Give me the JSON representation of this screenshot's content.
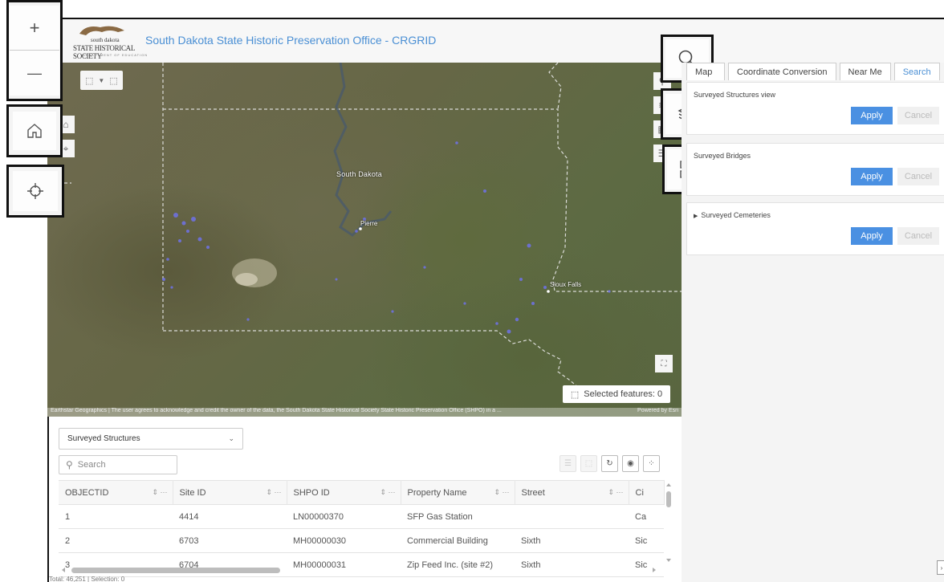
{
  "header": {
    "logo_line1": "south dakota",
    "logo_line2": "STATE HISTORICAL SOCIETY",
    "logo_line3": "DEPARTMENT OF EDUCATION",
    "title": "South Dakota State Historic Preservation Office - CRGRID"
  },
  "map": {
    "toolbar": {
      "select_icon": "select-by-rectangle-icon",
      "dropdown_icon": "chevron-down-icon",
      "clear_icon": "clear-selection-icon"
    },
    "labels": {
      "state": "South Dakota",
      "pierre": "Pierre",
      "sioux_falls": "Sioux Falls"
    },
    "selected_features_label": "Selected features: 0",
    "attribution_left": "Earthstar Geographics | The user agrees to acknowledge and credit the owner of the data, the South Dakota State Historical Society State Historic Preservation Office (SHPO) in a ...",
    "attribution_right": "Powered by Esri",
    "controls": {
      "zoom_in": "+",
      "zoom_out": "—",
      "home_icon": "home-icon",
      "locate_icon": "crosshair-icon",
      "search_icon": "search-icon",
      "layers_icon": "layers-icon",
      "basemap_icon": "basemap-gallery-icon"
    }
  },
  "attribute_table": {
    "layer_select_value": "Surveyed Structures",
    "search_placeholder": "Search",
    "columns": [
      "OBJECTID",
      "Site ID",
      "SHPO ID",
      "Property Name",
      "Street",
      "Ci"
    ],
    "rows": [
      [
        "1",
        "4414",
        "LN00000370",
        "SFP Gas Station",
        "",
        "Ca"
      ],
      [
        "2",
        "6703",
        "MH00000030",
        "Commercial Building",
        "Sixth",
        "Sic"
      ],
      [
        "3",
        "6704",
        "MH00000031",
        "Zip Feed Inc. (site #2)",
        "Sixth",
        "Sic"
      ]
    ],
    "status": "Total: 46,251 | Selection: 0"
  },
  "right_panel": {
    "tabs": [
      "Map",
      "Coordinate Conversion",
      "Near Me",
      "Search"
    ],
    "active_tab": "Search",
    "filters": [
      {
        "title": "Surveyed Structures view",
        "apply": "Apply",
        "cancel": "Cancel"
      },
      {
        "title": "Surveyed Bridges",
        "apply": "Apply",
        "cancel": "Cancel"
      },
      {
        "title": "Surveyed Cemeteries",
        "apply": "Apply",
        "cancel": "Cancel"
      }
    ]
  },
  "colors": {
    "accent": "#4a90e2",
    "title_blue": "#4a8fd4",
    "feature_points": "#6f72e8"
  }
}
